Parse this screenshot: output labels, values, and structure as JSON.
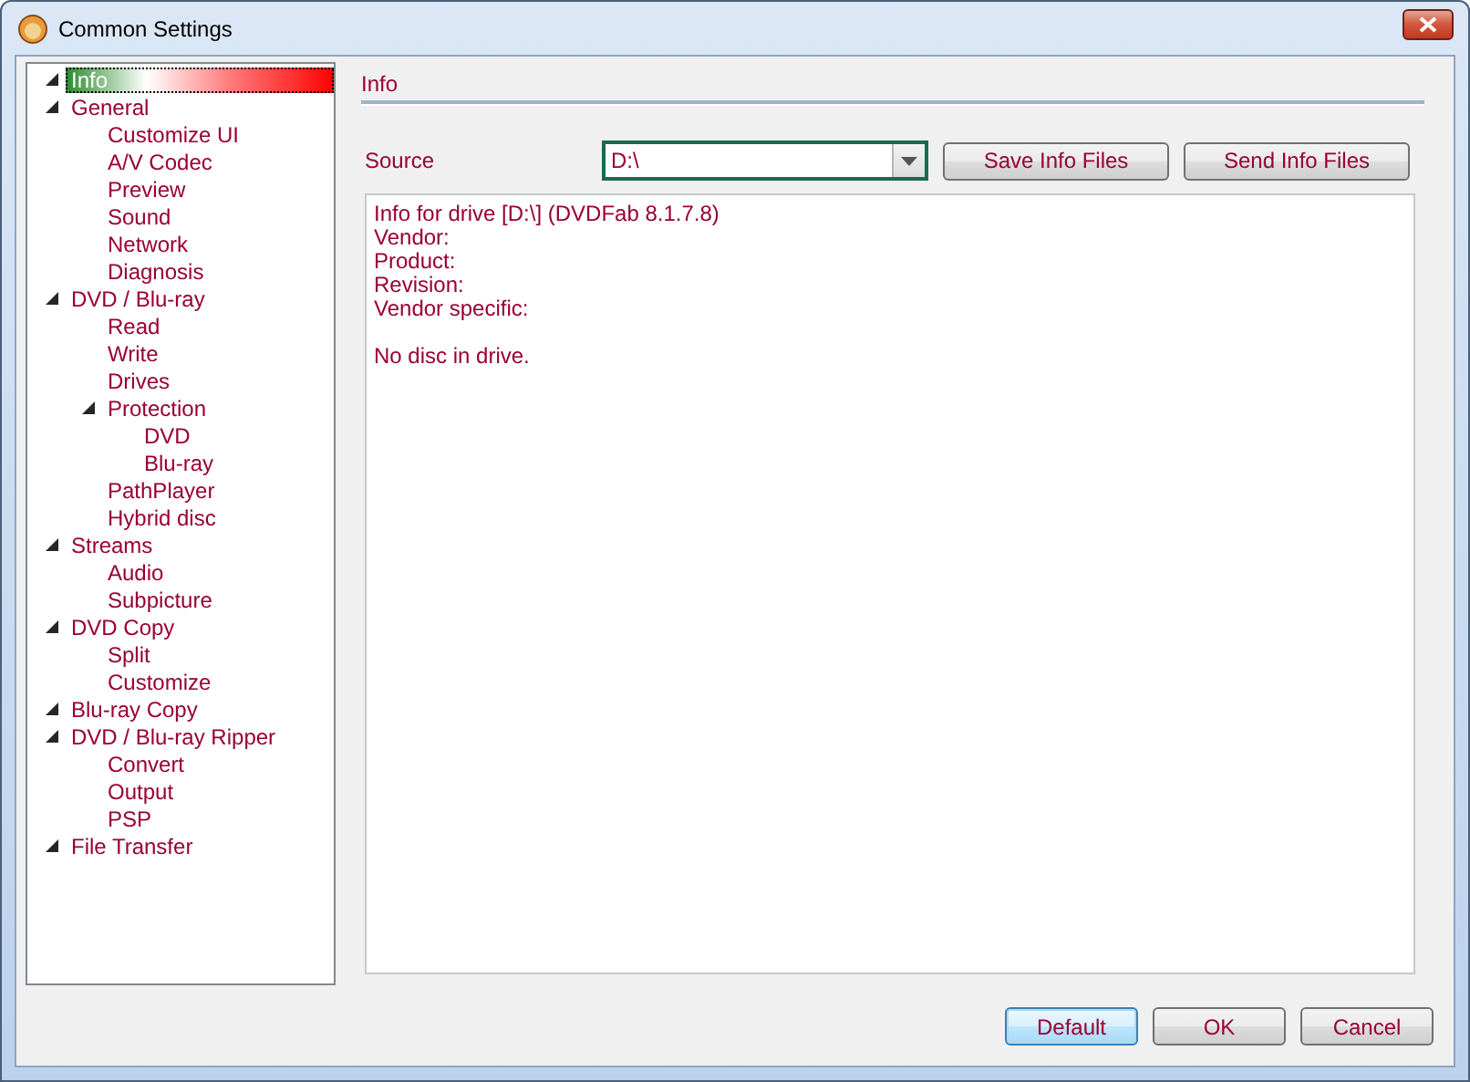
{
  "window": {
    "title": "Common Settings"
  },
  "tree": [
    {
      "label": "Info",
      "selected": true,
      "expanded": true
    },
    {
      "label": "General",
      "selected": false,
      "expanded": true,
      "children": [
        {
          "label": "Customize UI",
          "selected": false
        },
        {
          "label": "A/V Codec",
          "selected": false
        },
        {
          "label": "Preview",
          "selected": false
        },
        {
          "label": "Sound",
          "selected": false
        },
        {
          "label": "Network",
          "selected": false
        },
        {
          "label": "Diagnosis",
          "selected": false
        }
      ]
    },
    {
      "label": "DVD / Blu-ray",
      "selected": false,
      "expanded": true,
      "children": [
        {
          "label": "Read",
          "selected": false
        },
        {
          "label": "Write",
          "selected": false
        },
        {
          "label": "Drives",
          "selected": false
        },
        {
          "label": "Protection",
          "selected": false,
          "expanded": true,
          "children": [
            {
              "label": "DVD",
              "selected": false
            },
            {
              "label": "Blu-ray",
              "selected": false
            }
          ]
        },
        {
          "label": "PathPlayer",
          "selected": false
        },
        {
          "label": "Hybrid disc",
          "selected": false
        }
      ]
    },
    {
      "label": "Streams",
      "selected": false,
      "expanded": true,
      "children": [
        {
          "label": "Audio",
          "selected": false
        },
        {
          "label": "Subpicture",
          "selected": false
        }
      ]
    },
    {
      "label": "DVD Copy",
      "selected": false,
      "expanded": true,
      "children": [
        {
          "label": "Split",
          "selected": false
        },
        {
          "label": "Customize",
          "selected": false
        }
      ]
    },
    {
      "label": "Blu-ray Copy",
      "selected": false,
      "expanded": true
    },
    {
      "label": "DVD / Blu-ray Ripper",
      "selected": false,
      "expanded": true,
      "children": [
        {
          "label": "Convert",
          "selected": false
        },
        {
          "label": "Output",
          "selected": false
        },
        {
          "label": "PSP",
          "selected": false
        }
      ]
    },
    {
      "label": "File Transfer",
      "selected": false,
      "expanded": true
    }
  ],
  "panel": {
    "heading": "Info",
    "source_label": "Source",
    "source_value": "D:\\",
    "buttons": [
      "Save Info Files",
      "Send Info Files"
    ],
    "info_lines": [
      "Info for drive [D:\\] (DVDFab 8.1.7.8)",
      "Vendor:",
      "Product:",
      "Revision:",
      "Vendor specific:"
    ],
    "status": "No disc in drive."
  },
  "footer_buttons": [
    {
      "label": "Default",
      "focused": true
    },
    {
      "label": "OK",
      "focused": false
    },
    {
      "label": "Cancel",
      "focused": false
    }
  ]
}
